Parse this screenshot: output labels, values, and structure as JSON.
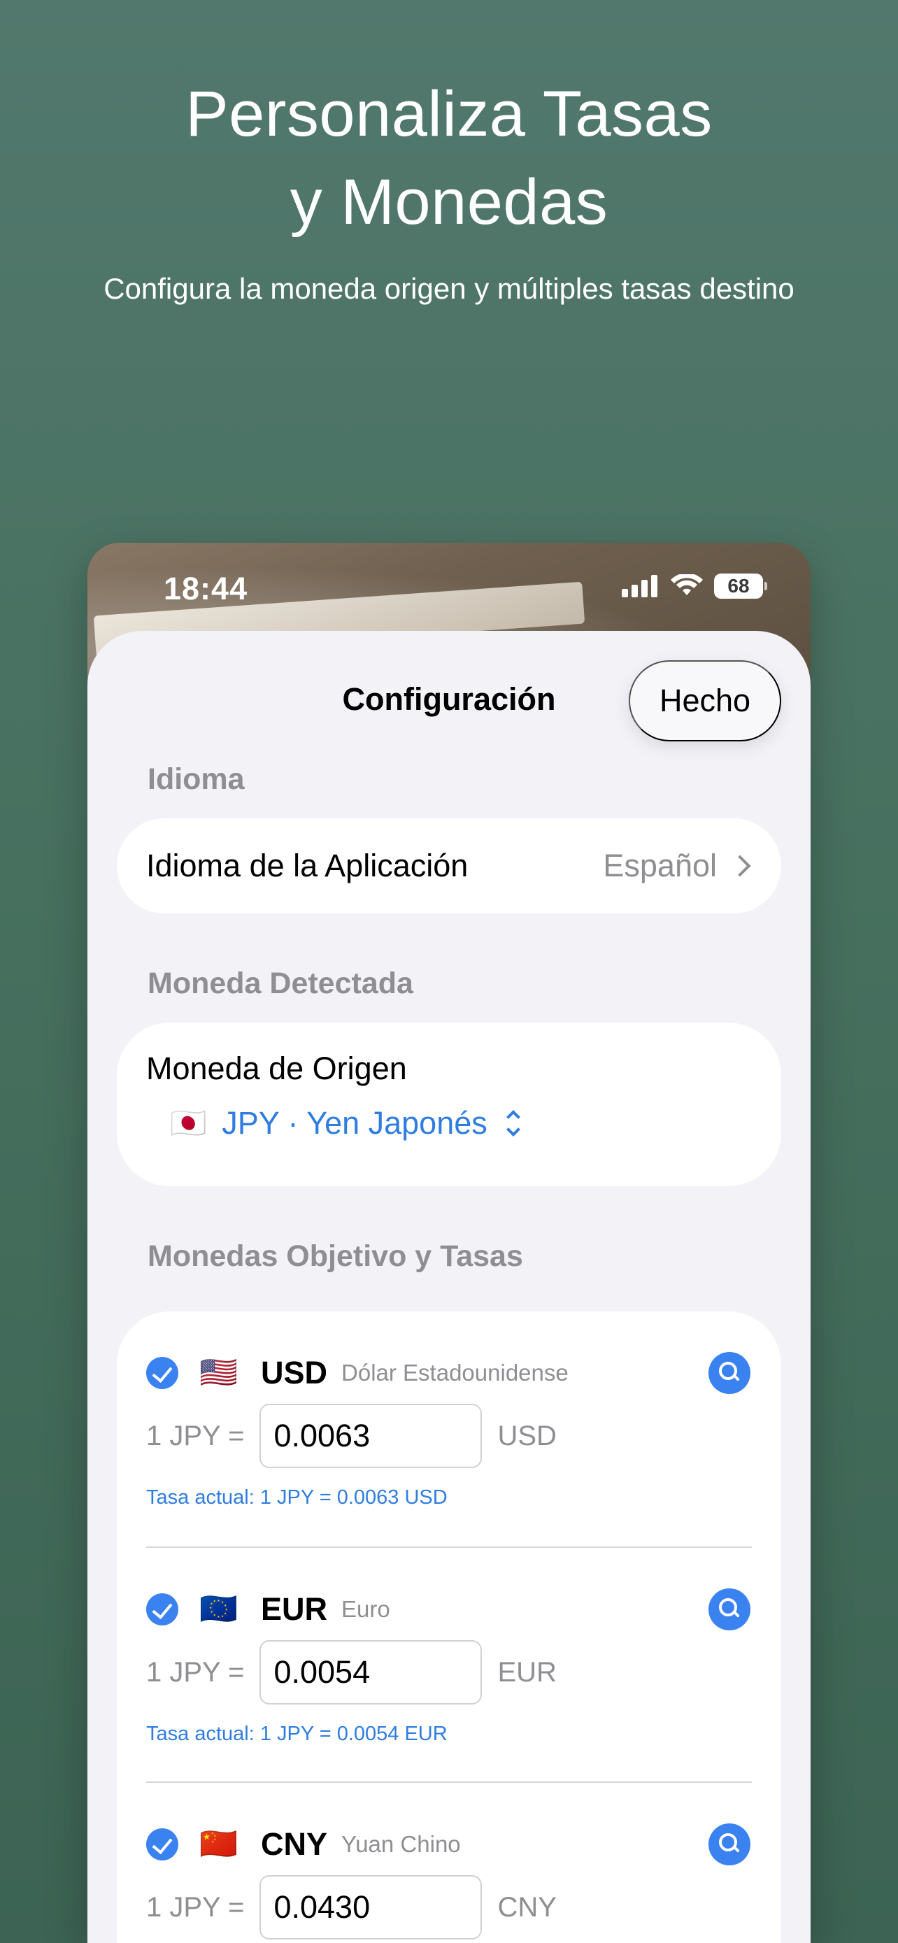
{
  "promo": {
    "title_line1": "Personaliza Tasas",
    "title_line2": "y Monedas",
    "subtitle": "Configura la moneda origen y múltiples tasas destino"
  },
  "status_bar": {
    "time": "18:44",
    "battery": "68",
    "icons": [
      "signal-icon",
      "wifi-icon",
      "battery-icon"
    ]
  },
  "nav": {
    "title": "Configuración",
    "done_label": "Hecho"
  },
  "language_section": {
    "header": "Idioma",
    "row_label": "Idioma de la Aplicación",
    "row_value": "Español"
  },
  "detected_section": {
    "header": "Moneda Detectada",
    "origin_label": "Moneda de Origen",
    "origin_flag": "🇯🇵",
    "origin_value": "JPY · Yen Japonés"
  },
  "targets_section": {
    "header": "Monedas Objetivo y Tasas",
    "items": [
      {
        "flag": "🇺🇸",
        "code": "USD",
        "name": "Dólar Estadounidense",
        "prefix": "1 JPY =",
        "rate": "0.0063",
        "unit": "USD",
        "current": "Tasa actual: 1 JPY = 0.0063 USD",
        "checked": true
      },
      {
        "flag": "🇪🇺",
        "code": "EUR",
        "name": "Euro",
        "prefix": "1 JPY =",
        "rate": "0.0054",
        "unit": "EUR",
        "current": "Tasa actual: 1 JPY = 0.0054 EUR",
        "checked": true
      },
      {
        "flag": "🇨🇳",
        "code": "CNY",
        "name": "Yuan Chino",
        "prefix": "1 JPY =",
        "rate": "0.0430",
        "unit": "CNY",
        "current": "",
        "checked": true
      }
    ]
  },
  "colors": {
    "accent": "#3a82f0",
    "link": "#2f7de1",
    "secondary_text": "#8e8e93",
    "sheet_bg": "#f2f2f7",
    "page_bg": "#4a7363"
  }
}
